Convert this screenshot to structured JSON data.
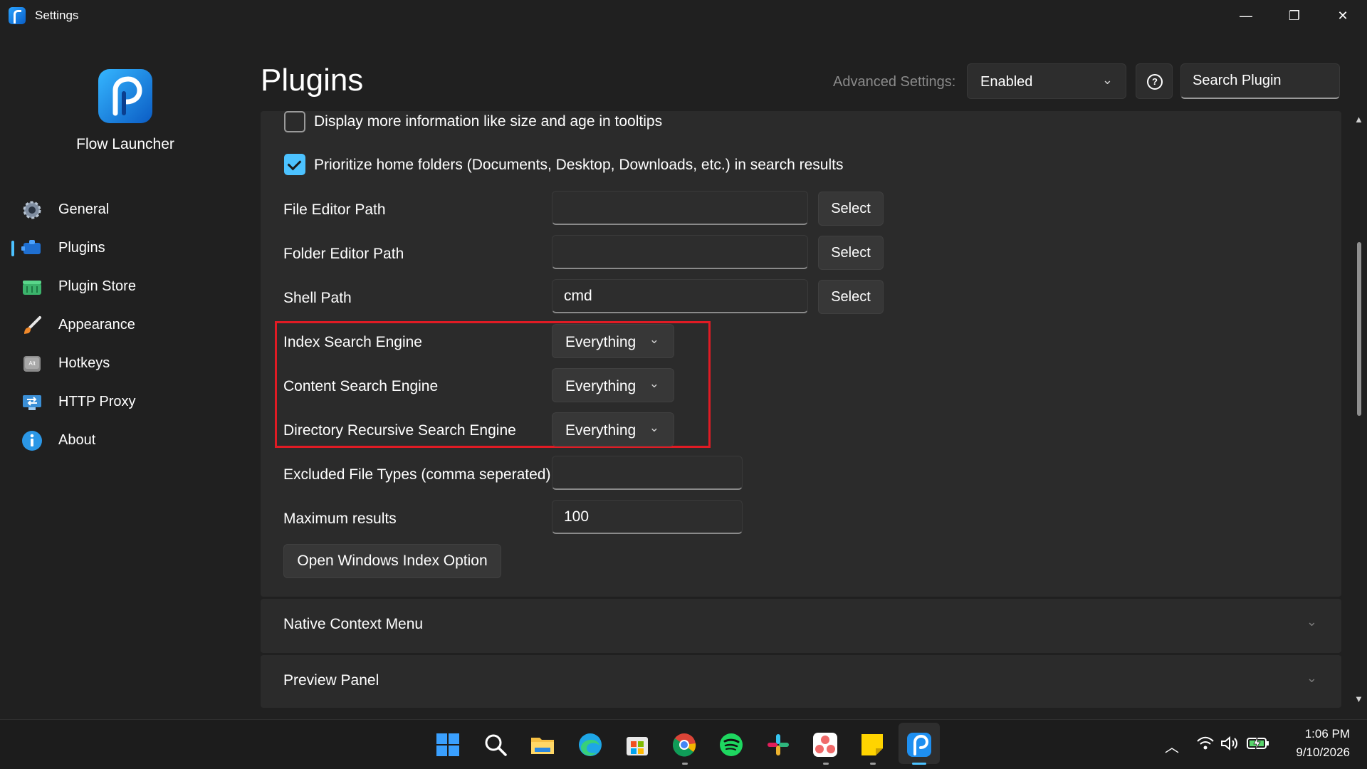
{
  "window": {
    "title": "Settings",
    "minimize_glyph": "—",
    "maximize_glyph": "❐",
    "close_glyph": "✕"
  },
  "sidebar": {
    "brand": "Flow Launcher",
    "items": [
      {
        "label": "General",
        "icon": "gear-icon",
        "color": "#8a9bb0"
      },
      {
        "label": "Plugins",
        "icon": "plugin-icon",
        "color": "#1f6fd1",
        "selected": true
      },
      {
        "label": "Plugin Store",
        "icon": "basket-icon",
        "color": "#3bb36b"
      },
      {
        "label": "Appearance",
        "icon": "brush-icon",
        "color": "#f0892b"
      },
      {
        "label": "Hotkeys",
        "icon": "keyboard-icon",
        "color": "#9a9a9a"
      },
      {
        "label": "HTTP Proxy",
        "icon": "proxy-icon",
        "color": "#3b8fd6"
      },
      {
        "label": "About",
        "icon": "info-icon",
        "color": "#2b97e6"
      }
    ]
  },
  "header": {
    "title": "Plugins",
    "advanced_label": "Advanced Settings:",
    "advanced_value": "Enabled",
    "help_glyph": "?",
    "search_placeholder": "Search Plugin"
  },
  "settings": {
    "display_more_info": {
      "label": "Display more information like size and age in tooltips",
      "checked": false
    },
    "prioritize_home": {
      "label": "Prioritize home folders (Documents, Desktop, Downloads, etc.) in search results",
      "checked": true
    },
    "file_editor_path": {
      "label": "File Editor Path",
      "value": "",
      "button": "Select"
    },
    "folder_editor_path": {
      "label": "Folder Editor Path",
      "value": "",
      "button": "Select"
    },
    "shell_path": {
      "label": "Shell Path",
      "value": "cmd",
      "button": "Select"
    },
    "index_search_engine": {
      "label": "Index Search Engine",
      "value": "Everything"
    },
    "content_search_engine": {
      "label": "Content Search Engine",
      "value": "Everything"
    },
    "directory_recursive_search_engine": {
      "label": "Directory Recursive Search Engine",
      "value": "Everything"
    },
    "excluded_file_types": {
      "label": "Excluded File Types (comma seperated)",
      "value": ""
    },
    "maximum_results": {
      "label": "Maximum results",
      "value": "100"
    },
    "open_index_button": "Open Windows Index Option"
  },
  "sections": [
    {
      "label": "Native Context Menu"
    },
    {
      "label": "Preview Panel"
    }
  ],
  "colors": {
    "accent": "#4cc2ff",
    "highlight_box": "#e01b24",
    "background": "#202020",
    "panel": "#2b2b2b"
  },
  "taskbar": {
    "apps": [
      "windows-start",
      "search",
      "file-explorer",
      "edge",
      "microsoft-store",
      "chrome",
      "spotify",
      "slack",
      "asana",
      "sticky-notes",
      "flow-launcher"
    ],
    "time": "1:06 PM",
    "date": "9/10/2026"
  }
}
